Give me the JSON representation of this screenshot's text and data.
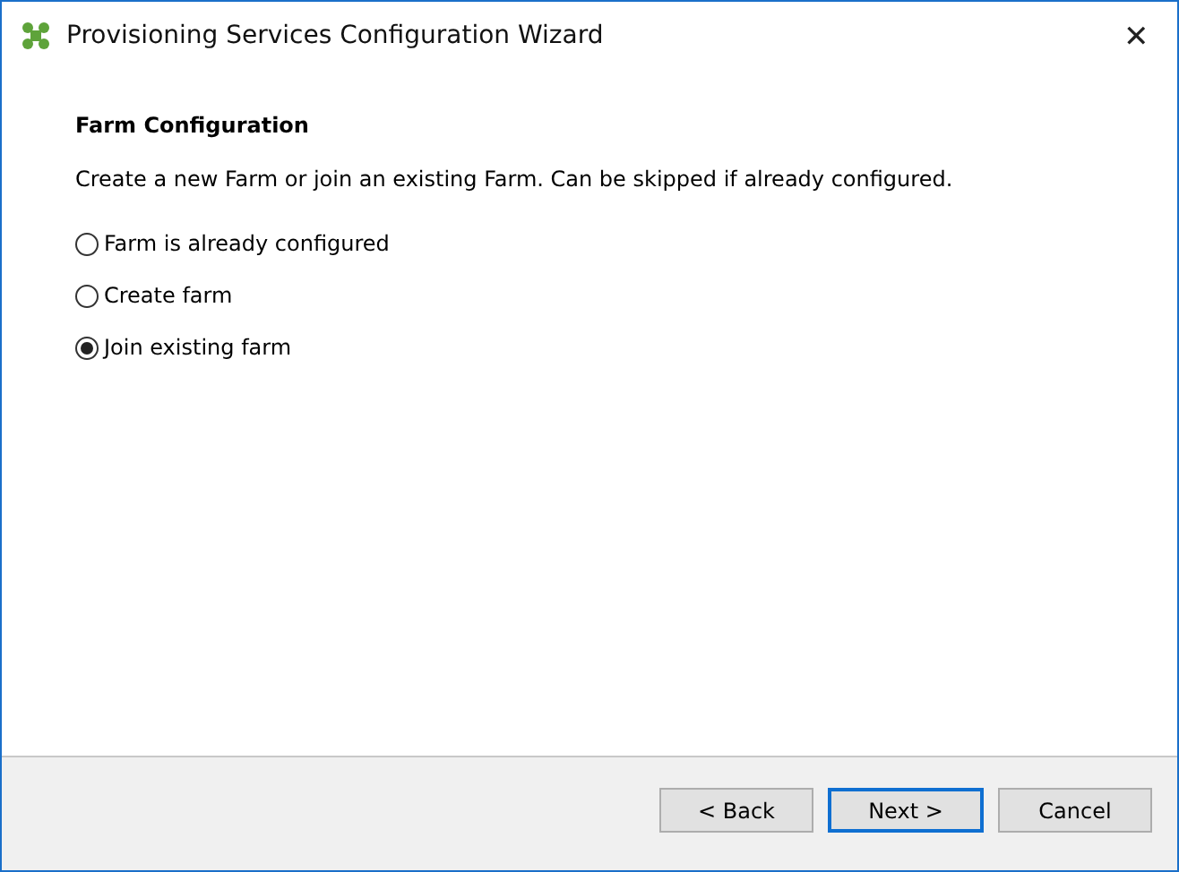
{
  "window": {
    "title": "Provisioning Services Configuration Wizard",
    "close": "✕"
  },
  "page": {
    "heading": "Farm Configuration",
    "description": "Create a new Farm or join an existing Farm. Can be skipped if already configured."
  },
  "options": [
    {
      "label": "Farm is already configured",
      "selected": false
    },
    {
      "label": "Create farm",
      "selected": false
    },
    {
      "label": "Join existing farm",
      "selected": true
    }
  ],
  "buttons": [
    {
      "label": "< Back",
      "default": false
    },
    {
      "label": "Next >",
      "default": true
    },
    {
      "label": "Cancel",
      "default": false
    }
  ]
}
